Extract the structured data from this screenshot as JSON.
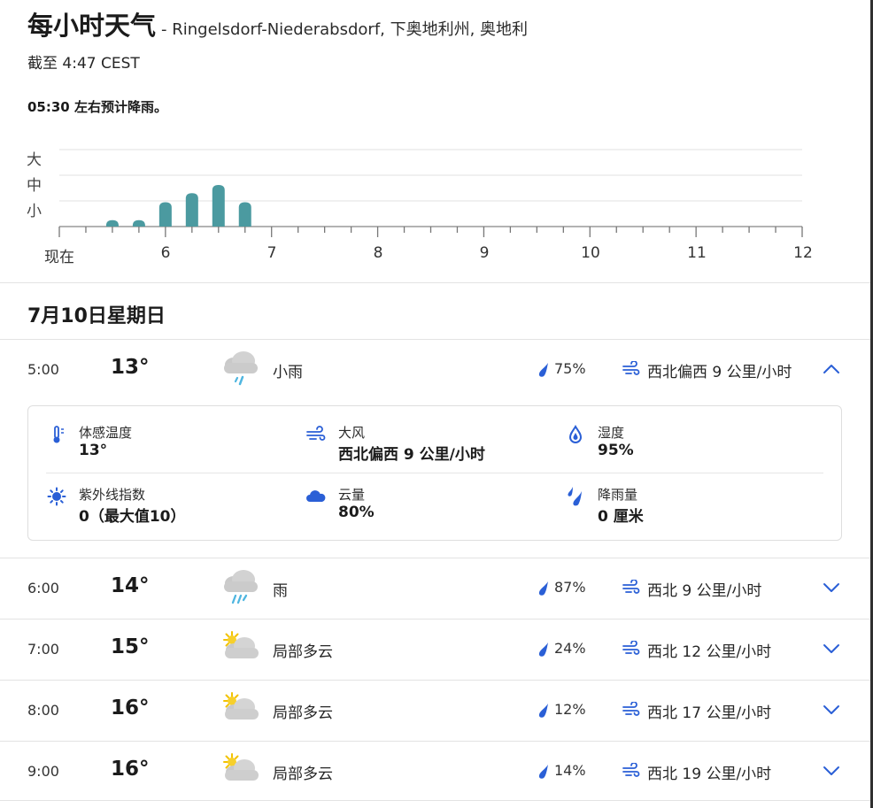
{
  "header": {
    "title": "每小时天气",
    "location": "- Ringelsdorf-Niederabsdorf, 下奥地利州, 奥地利",
    "updated": "截至 4:47 CEST",
    "forecast_note": "05:30 左右预计降雨。"
  },
  "chart_data": {
    "type": "bar",
    "y_categories": [
      "大",
      "中",
      "小"
    ],
    "x_tick_labels": [
      "现在",
      "6",
      "7",
      "8",
      "9",
      "10",
      "11",
      "12"
    ],
    "x": [
      "5:30",
      "5:45",
      "6:00",
      "6:15",
      "6:30",
      "6:45"
    ],
    "values": [
      0.25,
      0.25,
      0.95,
      1.3,
      1.62,
      0.95
    ],
    "ylim": [
      0,
      3
    ],
    "bar_color": "#4b9aa0",
    "grid": true
  },
  "day": {
    "heading": "7月10日星期日"
  },
  "rows": [
    {
      "time": "5:00",
      "temp": "13°",
      "icon": "light-rain-icon",
      "condition": "小雨",
      "precip": "75%",
      "wind": "西北偏西 9 公里/小时",
      "expanded": true
    },
    {
      "time": "6:00",
      "temp": "14°",
      "icon": "rain-icon",
      "condition": "雨",
      "precip": "87%",
      "wind": "西北 9 公里/小时",
      "expanded": false
    },
    {
      "time": "7:00",
      "temp": "15°",
      "icon": "partly-cloudy-icon",
      "condition": "局部多云",
      "precip": "24%",
      "wind": "西北 12 公里/小时",
      "expanded": false
    },
    {
      "time": "8:00",
      "temp": "16°",
      "icon": "partly-cloudy-icon",
      "condition": "局部多云",
      "precip": "12%",
      "wind": "西北 17 公里/小时",
      "expanded": false
    },
    {
      "time": "9:00",
      "temp": "16°",
      "icon": "partly-cloudy-icon",
      "condition": "局部多云",
      "precip": "14%",
      "wind": "西北 19 公里/小时",
      "expanded": false
    }
  ],
  "details": {
    "feels_like": {
      "label": "体感温度",
      "value": "13°",
      "icon": "thermometer-icon"
    },
    "wind": {
      "label": "大风",
      "value": "西北偏西 9 公里/小时",
      "icon": "wind-icon"
    },
    "humidity": {
      "label": "湿度",
      "value": "95%",
      "icon": "humidity-drop-icon"
    },
    "uv": {
      "label": "紫外线指数",
      "value": "0（最大值10）",
      "icon": "sun-uv-icon"
    },
    "cloud": {
      "label": "云量",
      "value": "80%",
      "icon": "cloud-icon"
    },
    "rain": {
      "label": "降雨量",
      "value": "0 厘米",
      "icon": "rain-amount-icon"
    }
  },
  "colors": {
    "accent": "#2a5fd6",
    "bar": "#4b9aa0",
    "text": "#1b1b1b",
    "divider": "#e3e3e3"
  }
}
